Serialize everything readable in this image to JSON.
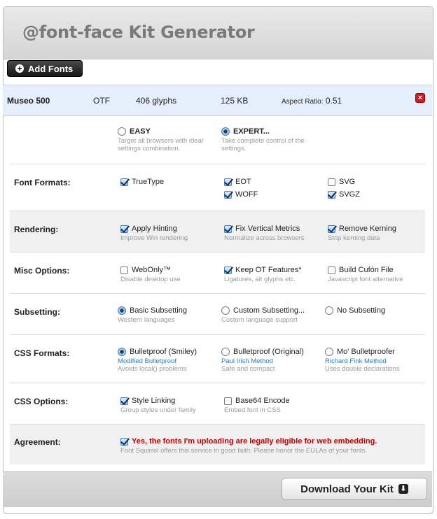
{
  "header": {
    "title": "@font-face Kit Generator"
  },
  "toolbar": {
    "add_fonts_label": "Add Fonts"
  },
  "font": {
    "name": "Museo 500",
    "format": "OTF",
    "glyphs": "406 glyphs",
    "size": "125 KB",
    "aspect_label": "Aspect Ratio:",
    "aspect_value": "0.51",
    "remove_icon": "x-icon"
  },
  "modes": {
    "easy": {
      "label": "EASY",
      "desc1": "Target all browsers with ideal",
      "desc2": "settings combination.",
      "selected": false
    },
    "expert": {
      "label": "EXPERT...",
      "desc1": "Take complete control of the",
      "desc2": "settings.",
      "selected": true
    }
  },
  "font_formats": {
    "label": "Font Formats:",
    "truetype": {
      "label": "TrueType",
      "checked": true
    },
    "eot": {
      "label": "EOT",
      "checked": true
    },
    "woff": {
      "label": "WOFF",
      "checked": true
    },
    "svg": {
      "label": "SVG",
      "checked": false
    },
    "svgz": {
      "label": "SVGZ",
      "checked": true
    }
  },
  "rendering": {
    "label": "Rendering:",
    "hinting": {
      "label": "Apply Hinting",
      "desc": "Improve Win rendering",
      "checked": true
    },
    "vertical": {
      "label": "Fix Vertical Metrics",
      "desc": "Normalize across browsers",
      "checked": true
    },
    "kerning": {
      "label": "Remove Kerning",
      "desc": "Strip kerning data",
      "checked": true
    }
  },
  "misc": {
    "label": "Misc Options:",
    "webonly": {
      "label": "WebOnly™",
      "desc": "Disable desktop use",
      "checked": false
    },
    "otfeatures": {
      "label": "Keep OT Features*",
      "desc": "Ligatures, alt glyphs etc.",
      "checked": true
    },
    "cufon": {
      "label": "Build Cufón File",
      "desc": "Javascript font alternative",
      "checked": false
    }
  },
  "subsetting": {
    "label": "Subsetting:",
    "basic": {
      "label": "Basic Subsetting",
      "desc": "Western languages",
      "selected": true
    },
    "custom": {
      "label": "Custom Subsetting...",
      "desc": "Custom language support",
      "selected": false
    },
    "none": {
      "label": "No Subsetting",
      "selected": false
    }
  },
  "css_formats": {
    "label": "CSS Formats:",
    "smiley": {
      "label": "Bulletproof (Smiley)",
      "link": "Modified Bulletproof",
      "desc": "Avoids local() problems",
      "selected": true
    },
    "original": {
      "label": "Bulletproof (Original)",
      "link": "Paul Irish Method",
      "desc": "Safe and compact",
      "selected": false
    },
    "mo": {
      "label": "Mo' Bulletproofer",
      "link": "Richard Fink Method",
      "desc": "Uses double declarations",
      "selected": false
    }
  },
  "css_options": {
    "label": "CSS Options:",
    "style_linking": {
      "label": "Style Linking",
      "desc": "Group styles under family",
      "checked": true
    },
    "base64": {
      "label": "Base64 Encode",
      "desc": "Embed font in CSS",
      "checked": false
    }
  },
  "agreement": {
    "label": "Agreement:",
    "text": "Yes, the fonts I'm uploading are legally eligible for web embedding.",
    "desc": "Font Squirrel offers this service in good faith. Please honor the EULAs of your fonts.",
    "checked": true,
    "text_color": "#c40000"
  },
  "footer": {
    "download_label": "Download Your Kit",
    "download_icon": "download-arrow-icon"
  }
}
